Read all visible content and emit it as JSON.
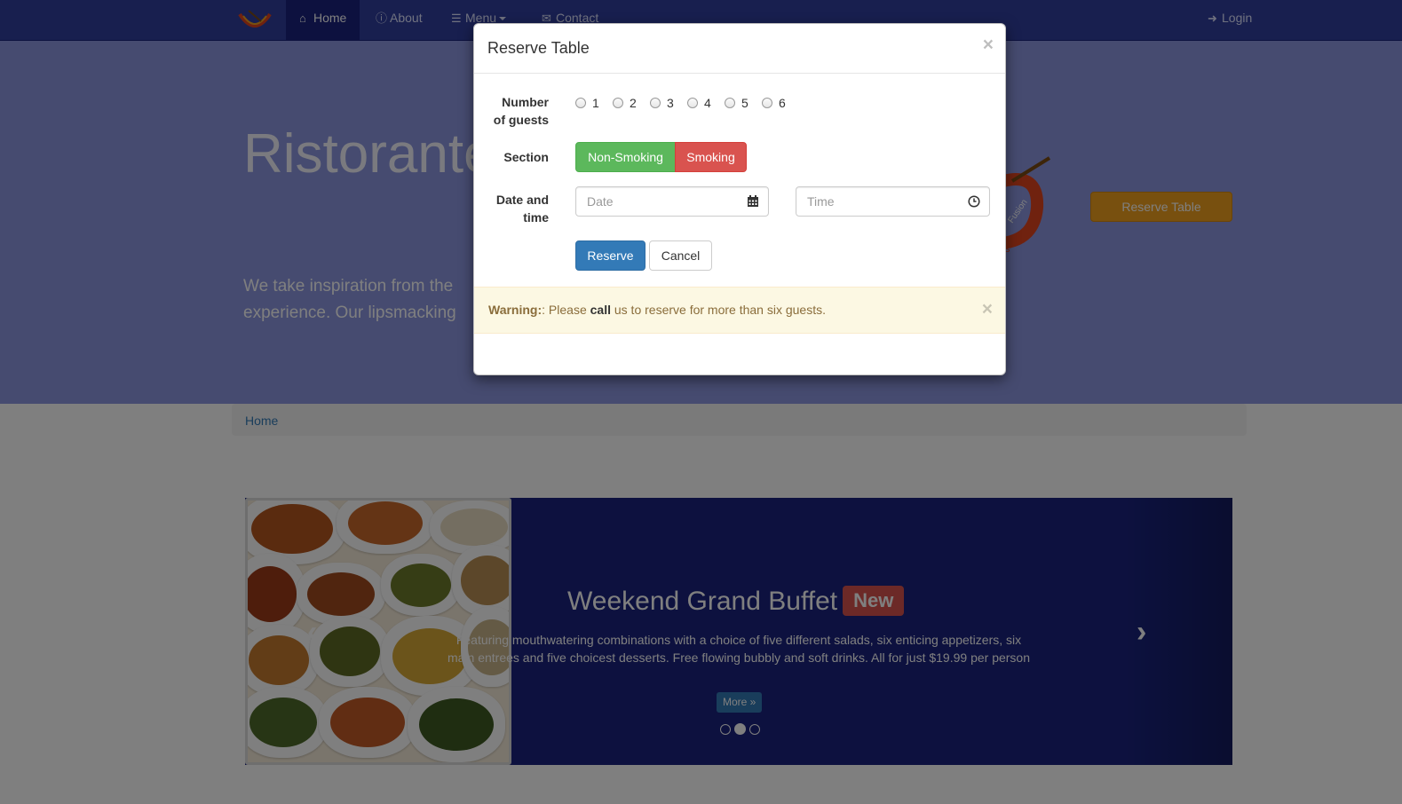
{
  "navbar": {
    "brand": "restaurant-logo-icon",
    "items": [
      {
        "label": "Home",
        "icon": "home-icon",
        "active": true
      },
      {
        "label": "About",
        "icon": "info-icon"
      },
      {
        "label": "Menu",
        "icon": "list-icon"
      },
      {
        "label": "Contact",
        "icon": "envelope-icon"
      }
    ],
    "login": {
      "label": "Login",
      "icon": "login-icon"
    },
    "colors": {
      "bar": "#303F9F",
      "active": "#1A237E"
    }
  },
  "jumbotron": {
    "title": "Ristorante",
    "text_line1": "We take inspiration from the",
    "text_line2": "experience. Our lipsmacking",
    "reserve_button": "Reserve Table",
    "logo_text": "Fusion",
    "logo_suffix": "s"
  },
  "breadcrumb": {
    "current": "Home"
  },
  "carousel": {
    "title": "Weekend Grand Buffet",
    "badge": "New",
    "description": "Featuring mouthwatering combinations with a choice of five different salads, six enticing appetizers, six main entrees and five choicest desserts. Free flowing bubbly and soft drinks. All for just $19.99 per person",
    "more_button": "More »",
    "prev_icon": "chevron-left-icon",
    "next_icon": "chevron-right-icon",
    "active_slide_number": 2,
    "total_slides": 3
  },
  "modal": {
    "title": "Reserve Table",
    "close": "×",
    "guests": {
      "label_line1": "Number",
      "label_line2": "of guests",
      "options": [
        "1",
        "2",
        "3",
        "4",
        "5",
        "6"
      ]
    },
    "section": {
      "label": "Section",
      "non_smoking": "Non-Smoking",
      "smoking": "Smoking"
    },
    "datetime": {
      "label_line1": "Date and",
      "label_line2": "time",
      "date_placeholder": "Date",
      "time_placeholder": "Time",
      "date_icon": "calendar-icon",
      "time_icon": "clock-icon"
    },
    "reserve_button": "Reserve",
    "cancel_button": "Cancel",
    "alert": {
      "strong": "Warning:",
      "text1": ": Please ",
      "bold": "call",
      "text2": " us to reserve for more than six guests.",
      "close": "×"
    }
  }
}
